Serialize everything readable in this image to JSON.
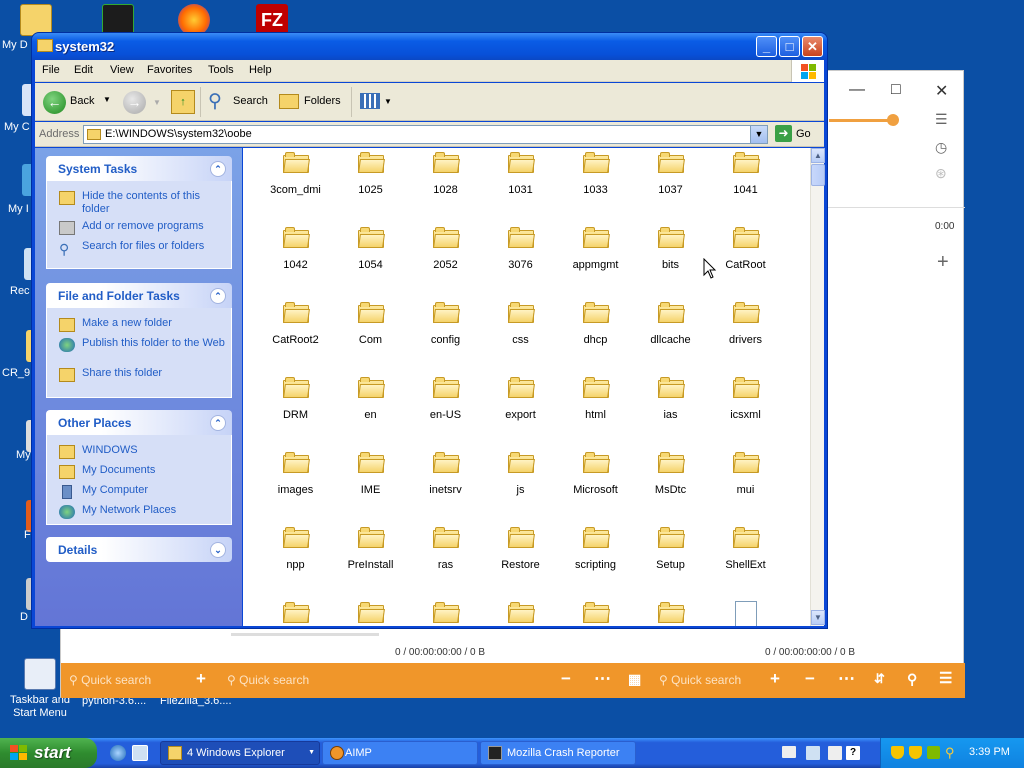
{
  "desktop": {
    "icons": [
      {
        "label": "My D"
      },
      {
        "label": "My C"
      },
      {
        "label": "My I"
      },
      {
        "label": "Rec"
      },
      {
        "label": "CR_9"
      },
      {
        "label": "My"
      },
      {
        "label": "F"
      },
      {
        "label": "D"
      },
      {
        "label": "Taskbar and Start Menu"
      },
      {
        "label": "python-3.6...."
      },
      {
        "label": "FileZilla_3.6...."
      }
    ]
  },
  "aimp": {
    "time_label": "0:00",
    "status_left": "0 / 00:00:00:00 / 0 B",
    "status_right": "0 / 00:00:00:00 / 0 B",
    "search_placeholder": "Quick search",
    "colors": {
      "accent": "#f0962a"
    }
  },
  "explorer": {
    "title": "system32",
    "menu": [
      "File",
      "Edit",
      "View",
      "Favorites",
      "Tools",
      "Help"
    ],
    "toolbar": {
      "back": "Back",
      "search": "Search",
      "folders": "Folders"
    },
    "address_label": "Address",
    "address_value": "E:\\WINDOWS\\system32\\oobe",
    "go_label": "Go",
    "system_tasks": {
      "title": "System Tasks",
      "items": [
        "Hide the contents of this folder",
        "Add or remove programs",
        "Search for files or folders"
      ]
    },
    "file_tasks": {
      "title": "File and Folder Tasks",
      "items": [
        "Make a new folder",
        "Publish this folder to the Web",
        "Share this folder"
      ]
    },
    "other_places": {
      "title": "Other Places",
      "items": [
        "WINDOWS",
        "My Documents",
        "My Computer",
        "My Network Places"
      ]
    },
    "details": {
      "title": "Details"
    },
    "files": [
      "3com_dmi",
      "1025",
      "1028",
      "1031",
      "1033",
      "1037",
      "1041",
      "1042",
      "1054",
      "2052",
      "3076",
      "appmgmt",
      "bits",
      "CatRoot",
      "CatRoot2",
      "Com",
      "config",
      "css",
      "dhcp",
      "dllcache",
      "drivers",
      "DRM",
      "en",
      "en-US",
      "export",
      "html",
      "ias",
      "icsxml",
      "images",
      "IME",
      "inetsrv",
      "js",
      "Microsoft",
      "MsDtc",
      "mui",
      "npp",
      "PreInstall",
      "ras",
      "Restore",
      "scripting",
      "Setup",
      "ShellExt"
    ]
  },
  "taskbar": {
    "start": "start",
    "items": [
      {
        "label": "4 Windows Explorer",
        "icon": "folder-icon"
      },
      {
        "label": "AIMP",
        "icon": "aimp-icon"
      },
      {
        "label": "Mozilla Crash Reporter",
        "icon": "crash-reporter-icon"
      }
    ],
    "clock": "3:39 PM"
  }
}
